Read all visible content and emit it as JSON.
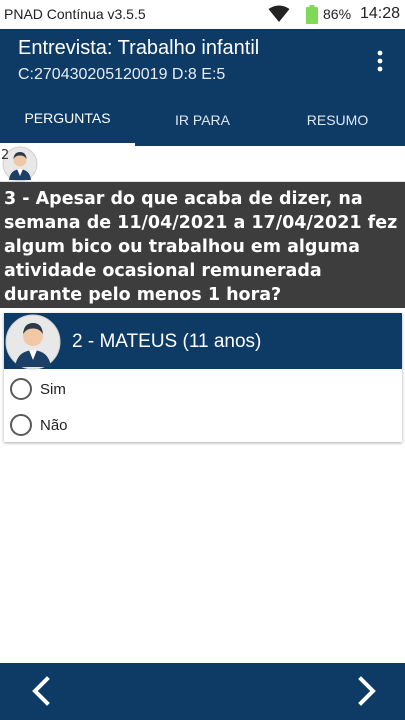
{
  "status_bar": {
    "app_name": "PNAD Contínua v3.5.5",
    "battery": "86%",
    "time": "14:28",
    "icons": [
      "wifi-icon",
      "battery-icon"
    ]
  },
  "header": {
    "title": "Entrevista: Trabalho infantil",
    "subtitle": "C:270430205120019 D:8 E:5",
    "menu_icon": "more-vert-icon"
  },
  "tabs": [
    {
      "label": "PERGUNTAS",
      "selected": true
    },
    {
      "label": "IR PARA",
      "selected": false
    },
    {
      "label": "RESUMO",
      "selected": false
    }
  ],
  "member_strip": {
    "number": "2"
  },
  "question": {
    "text": "3 - Apesar do que acaba de dizer, na semana de 11/04/2021 a 17/04/2021 fez algum bico ou trabalhou em alguma atividade ocasional remunerada durante pelo menos 1 hora?"
  },
  "person": {
    "name": "2 - MATEUS (11 anos)"
  },
  "options": [
    {
      "label": "Sim",
      "selected": false
    },
    {
      "label": "Não",
      "selected": false
    }
  ],
  "colors": {
    "primary": "#0d3b66",
    "question_bg": "#3d3d3d",
    "battery": "#7ed957"
  }
}
